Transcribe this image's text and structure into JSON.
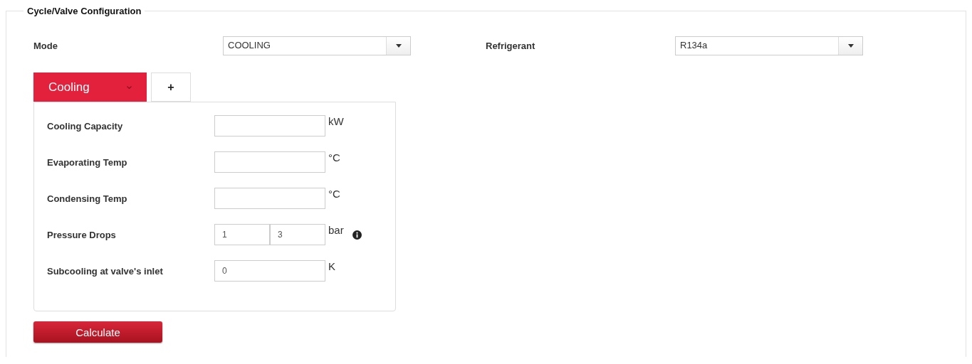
{
  "section": {
    "title": "Cycle/Valve Configuration"
  },
  "selects": [
    {
      "label": "Mode",
      "value": "COOLING"
    },
    {
      "label": "Refrigerant",
      "value": "R134a"
    }
  ],
  "tabs": [
    {
      "kind": "tab",
      "label": "Cooling",
      "selected": true
    },
    {
      "kind": "add",
      "label": "+",
      "selected": false
    }
  ],
  "fields": [
    {
      "kind": "single",
      "label": "Cooling Capacity",
      "unit": "kW"
    },
    {
      "kind": "single",
      "label": "Evaporating Temp",
      "unit": "°C"
    },
    {
      "kind": "single",
      "label": "Condensing Temp",
      "unit": "°C"
    },
    {
      "kind": "pair",
      "label": "Pressure Drops",
      "values": [
        "1",
        "3"
      ],
      "unit": "bar",
      "info": true
    },
    {
      "kind": "single",
      "label": "Subcooling at valve's inlet",
      "value": "0",
      "unit": "K"
    }
  ],
  "button": {
    "label": "Calculate"
  }
}
